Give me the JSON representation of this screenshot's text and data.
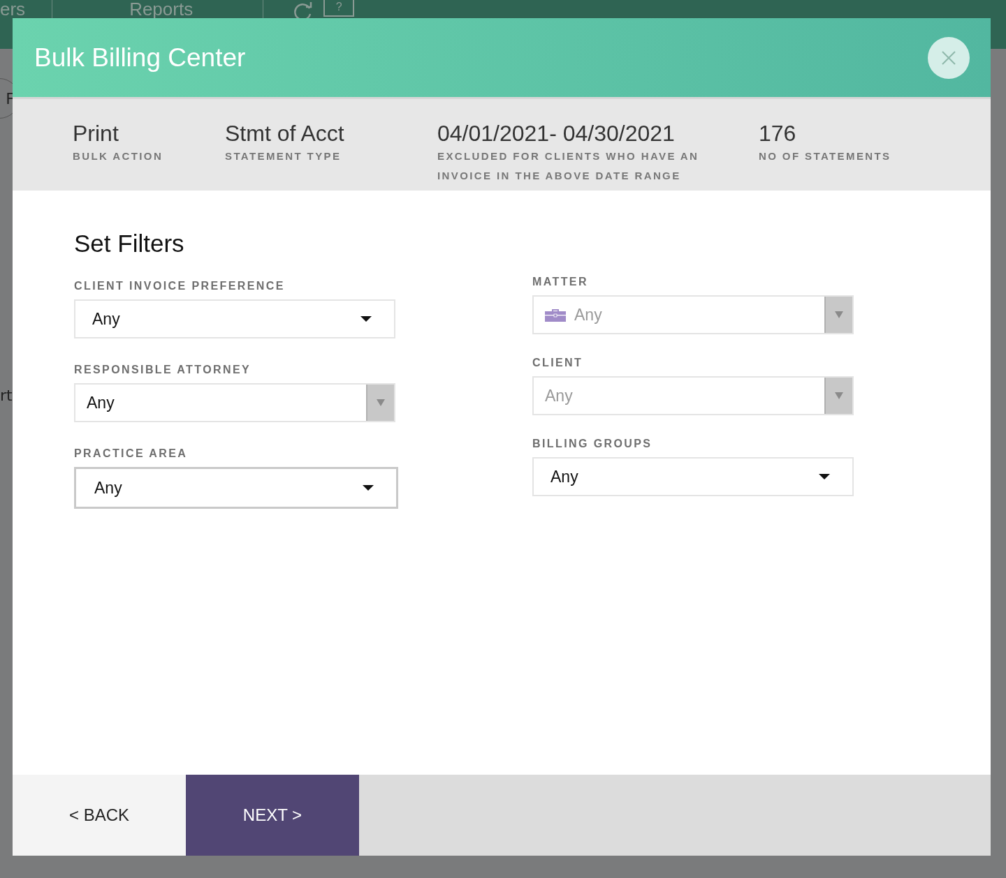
{
  "background": {
    "nav_items": [
      "ers",
      "Reports"
    ],
    "help_mark": "?",
    "side_button": "F",
    "side_text": "rt"
  },
  "dialog": {
    "title": "Bulk Billing Center"
  },
  "summary": [
    {
      "value": "Print",
      "label": "BULK ACTION"
    },
    {
      "value": "Stmt of Acct",
      "label": "STATEMENT TYPE"
    },
    {
      "value": "04/01/2021- 04/30/2021",
      "label": "EXCLUDED FOR CLIENTS WHO HAVE AN INVOICE IN THE ABOVE DATE RANGE"
    },
    {
      "value": "176",
      "label": "NO OF STATEMENTS"
    }
  ],
  "filters_title": "Set Filters",
  "filters_left": [
    {
      "label": "CLIENT INVOICE PREFERENCE",
      "value": "Any",
      "kind": "select",
      "focused": false
    },
    {
      "label": "RESPONSIBLE ATTORNEY",
      "value": "Any",
      "kind": "combo",
      "focused": false
    },
    {
      "label": "PRACTICE AREA",
      "value": "Any",
      "kind": "select",
      "focused": true
    }
  ],
  "filters_right": [
    {
      "label": "MATTER",
      "placeholder": "Any",
      "kind": "combo",
      "focused": false,
      "icon": true
    },
    {
      "label": "CLIENT",
      "placeholder": "Any",
      "kind": "combo",
      "focused": false
    },
    {
      "label": "BILLING GROUPS",
      "value": "Any",
      "kind": "select",
      "focused": false
    }
  ],
  "buttons": {
    "back": "< BACK",
    "next": "NEXT >"
  }
}
